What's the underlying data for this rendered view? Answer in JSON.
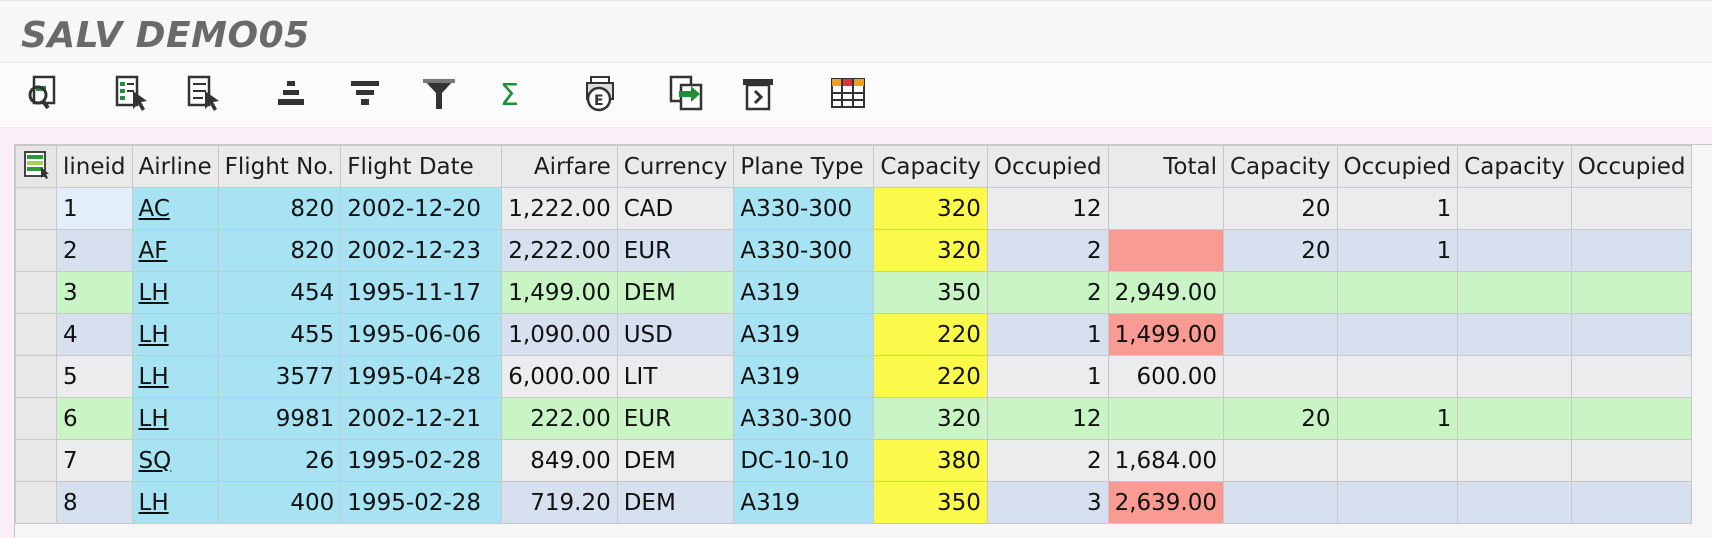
{
  "window": {
    "title": "SALV DEMO05"
  },
  "toolbar": {
    "buttons": [
      {
        "name": "details-icon"
      },
      {
        "name": "select-all-icon"
      },
      {
        "name": "deselect-all-icon"
      },
      {
        "name": "sort-ascending-icon"
      },
      {
        "name": "sort-descending-icon"
      },
      {
        "name": "filter-icon"
      },
      {
        "name": "sum-icon"
      },
      {
        "name": "print-preview-icon"
      },
      {
        "name": "export-icon"
      },
      {
        "name": "change-layout-icon"
      },
      {
        "name": "choose-layout-icon"
      }
    ]
  },
  "grid": {
    "columns": [
      "lineid",
      "Airline",
      "Flight No.",
      "Flight Date",
      "Airfare",
      "Currency",
      "Plane Type",
      "Capacity",
      "Occupied",
      "Total",
      "Capacity",
      "Occupied",
      "Capacity",
      "Occupied"
    ],
    "rows": [
      {
        "lineid": "1",
        "airline": "AC",
        "flight_no": "820",
        "flight_date": "2002-12-20",
        "airfare": "1,222.00",
        "currency": "CAD",
        "plane_type": "A330-300",
        "capacity": "320",
        "occupied": "12",
        "total": "",
        "capacity2": "20",
        "occupied2": "1",
        "capacity3": "",
        "occupied3": ""
      },
      {
        "lineid": "2",
        "airline": "AF",
        "flight_no": "820",
        "flight_date": "2002-12-23",
        "airfare": "2,222.00",
        "currency": "EUR",
        "plane_type": "A330-300",
        "capacity": "320",
        "occupied": "2",
        "total": "",
        "capacity2": "20",
        "occupied2": "1",
        "capacity3": "",
        "occupied3": ""
      },
      {
        "lineid": "3",
        "airline": "LH",
        "flight_no": "454",
        "flight_date": "1995-11-17",
        "airfare": "1,499.00",
        "currency": "DEM",
        "plane_type": "A319",
        "capacity": "350",
        "occupied": "2",
        "total": "2,949.00",
        "capacity2": "",
        "occupied2": "",
        "capacity3": "",
        "occupied3": ""
      },
      {
        "lineid": "4",
        "airline": "LH",
        "flight_no": "455",
        "flight_date": "1995-06-06",
        "airfare": "1,090.00",
        "currency": "USD",
        "plane_type": "A319",
        "capacity": "220",
        "occupied": "1",
        "total": "1,499.00",
        "capacity2": "",
        "occupied2": "",
        "capacity3": "",
        "occupied3": ""
      },
      {
        "lineid": "5",
        "airline": "LH",
        "flight_no": "3577",
        "flight_date": "1995-04-28",
        "airfare": "6,000.00",
        "currency": "LIT",
        "plane_type": "A319",
        "capacity": "220",
        "occupied": "1",
        "total": "600.00",
        "capacity2": "",
        "occupied2": "",
        "capacity3": "",
        "occupied3": ""
      },
      {
        "lineid": "6",
        "airline": "LH",
        "flight_no": "9981",
        "flight_date": "2002-12-21",
        "airfare": "222.00",
        "currency": "EUR",
        "plane_type": "A330-300",
        "capacity": "320",
        "occupied": "12",
        "total": "",
        "capacity2": "20",
        "occupied2": "1",
        "capacity3": "",
        "occupied3": ""
      },
      {
        "lineid": "7",
        "airline": "SQ",
        "flight_no": "26",
        "flight_date": "1995-02-28",
        "airfare": "849.00",
        "currency": "DEM",
        "plane_type": "DC-10-10",
        "capacity": "380",
        "occupied": "2",
        "total": "1,684.00",
        "capacity2": "",
        "occupied2": "",
        "capacity3": "",
        "occupied3": ""
      },
      {
        "lineid": "8",
        "airline": "LH",
        "flight_no": "400",
        "flight_date": "1995-02-28",
        "airfare": "719.20",
        "currency": "DEM",
        "plane_type": "A319",
        "capacity": "350",
        "occupied": "3",
        "total": "2,639.00",
        "capacity2": "",
        "occupied2": "",
        "capacity3": "",
        "occupied3": ""
      }
    ]
  },
  "colors": {
    "cyan_cell": "#a7e3f2",
    "yellow_cell": "#fbf94a",
    "salmon_cell": "#f99b92",
    "green_row": "#c8f5c3",
    "blue_row": "#d7e0ee",
    "grey_row": "#eaecee",
    "sum_icon": "#1f8f3a"
  }
}
